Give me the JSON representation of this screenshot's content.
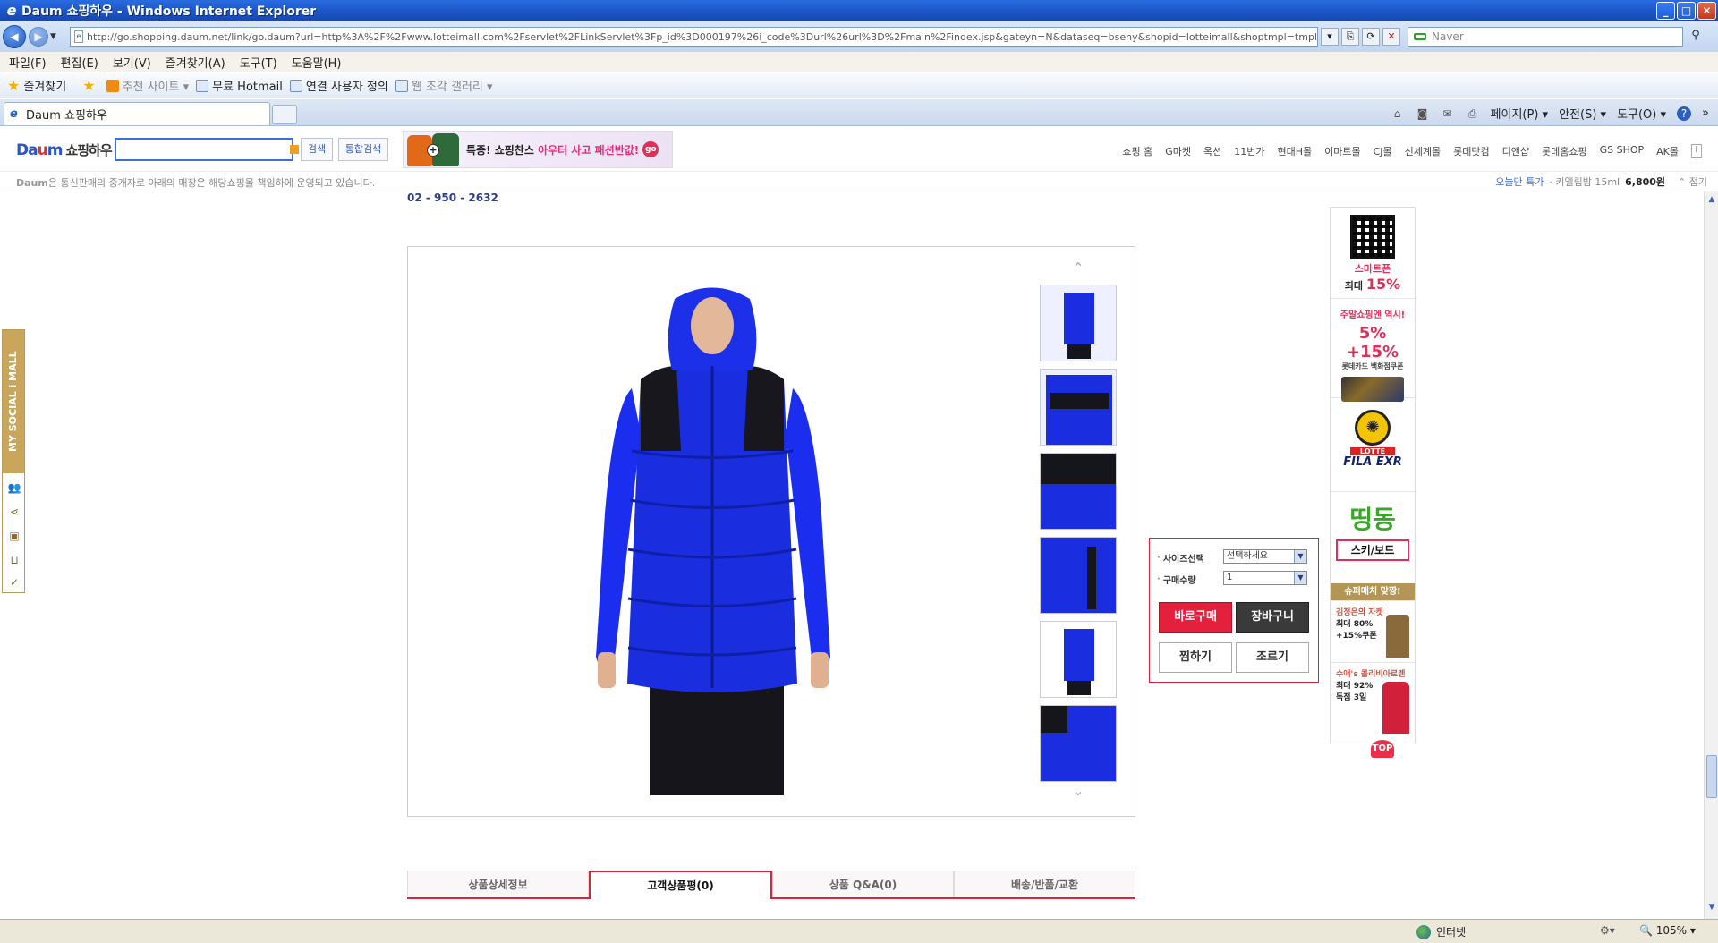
{
  "window": {
    "title": "Daum 쇼핑하우 - Windows Internet Explorer",
    "controls": [
      "_",
      "□",
      "✕"
    ]
  },
  "address": {
    "url": "http://go.shopping.daum.net/link/go.daum?url=http%3A%2F%2Fwww.lotteimall.com%2Fservlet%2FLinkServlet%3Fp_id%3D000197%26i_code%3Durl%26url%3D%2Fmain%2Findex.jsp&gateyn=N&dataseq=bseny&shopid=lotteimall&shoptmpl=tmpl",
    "search_placeholder": "Naver"
  },
  "menu": {
    "items": [
      "파일(F)",
      "편집(E)",
      "보기(V)",
      "즐겨찾기(A)",
      "도구(T)",
      "도움말(H)"
    ]
  },
  "favorites": {
    "label": "즐겨찾기",
    "items": [
      "추천 사이트 ▾",
      "무료 Hotmail",
      "연결 사용자 정의",
      "웹 조각 갤러리 ▾"
    ]
  },
  "tabs": {
    "active": "Daum 쇼핑하우"
  },
  "command_bar": {
    "items": [
      "페이지(P) ▾",
      "안전(S) ▾",
      "도구(O) ▾"
    ],
    "help": "?",
    "more": "»"
  },
  "daum": {
    "logo_a": "Da",
    "logo_m": "u",
    "logo_b": "m",
    "logo_sub": "쇼핑하우",
    "search_button": "검색",
    "integrated_search_button": "통합검색",
    "banner_text_a": "특증! 쇼핑찬스",
    "banner_text_b": "아우터 사고 패션반값!",
    "banner_go": "go",
    "mall_nav": [
      "쇼핑 홈",
      "G마켓",
      "옥션",
      "11번가",
      "현대H몰",
      "이마트몰",
      "CJ몰",
      "신세계몰",
      "롯데닷컴",
      "디앤샵",
      "롯데홈쇼핑",
      "GS SHOP",
      "AK몰"
    ],
    "mall_nav_more": "+",
    "notice_brand": "Daum",
    "notice_text": "은 통신판매의 중개자로 아래의 매장은 해당쇼핑몰 책임하에 운영되고 있습니다.",
    "today_label": "오늘만 특가",
    "today_item": "· 키엘립밤 15ml",
    "today_price": "6,800원",
    "fold": "⌃ 접기"
  },
  "page": {
    "phone": "02 - 950 - 2632",
    "social_label": "MY SOCIAL i MALL",
    "social_icons": [
      "people-icon",
      "share-icon",
      "gift-icon",
      "cart-icon",
      "check-icon"
    ]
  },
  "product": {
    "thumb_up": "⌃",
    "thumb_down": "⌄",
    "options": {
      "size_label": "사이즈선택",
      "size_value": "선택하세요",
      "qty_label": "구매수량",
      "qty_value": "1"
    },
    "buttons": {
      "buy_now": "바로구매",
      "cart": "장바구니",
      "wish": "찜하기",
      "push": "조르기"
    },
    "tabs": [
      "상품상세정보",
      "고객상품평(0)",
      "상품 Q&A(0)",
      "배송/반품/교환"
    ],
    "active_tab_index": 1
  },
  "rail": {
    "smartphone": "스마트폰",
    "max": "최대",
    "pct15": "15%",
    "weekend": "주말쇼핑엔 역시!",
    "weekend_offer": "5% +15%",
    "weekend_sub": "롯데카드   백화점쿠폰",
    "fila_badge": "LOTTE",
    "fila": "FILA EXR",
    "ttingdong": "띵동",
    "ski": "스키/보드",
    "super_match": "슈퍼매치 맞짱!",
    "kim_title": "김정은의 자켓",
    "kim_offer": "최대 80%",
    "kim_coupon": "+15%쿠폰",
    "suhae_title": "수애's 콜리비아로렌",
    "suhae_offer": "최대 92%",
    "suhae_days": "독점 3일",
    "top": "TOP"
  },
  "status": {
    "zone": "인터넷",
    "zoom": "105% ▾"
  },
  "colors": {
    "accent_red": "#d8243c",
    "jacket_blue": "#1a2ee0",
    "ie_blue": "#1c56c8"
  }
}
